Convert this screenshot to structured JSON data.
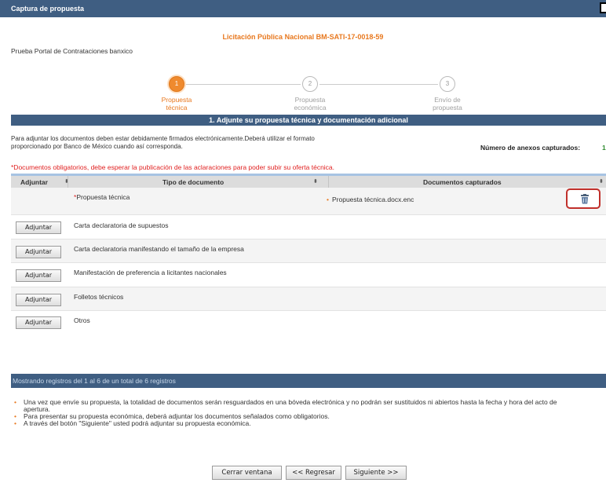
{
  "window": {
    "title": "Captura de propuesta"
  },
  "header": {
    "licitacion": "Licitación Pública Nacional BM-SATI-17-0018-59",
    "proceso": "Prueba Portal de Contrataciones banxico"
  },
  "steps": [
    {
      "number": "1",
      "line1": "Propuesta",
      "line2": "técnica",
      "state": "active"
    },
    {
      "number": "2",
      "line1": "Propuesta",
      "line2": "económica",
      "state": "pending"
    },
    {
      "number": "3",
      "line1": "Envío de",
      "line2": "propuesta",
      "state": "pending"
    }
  ],
  "section": {
    "title": "1. Adjunte su propuesta técnica y documentación adicional"
  },
  "instructions": {
    "line1": "Para adjuntar los documentos deben estar debidamente firmados electrónicamente.Deberá utilizar el formato",
    "line2": "proporcionado por Banco de México cuando así corresponda."
  },
  "anexos": {
    "label": "Número de anexos capturados:",
    "value": "1"
  },
  "warning": "*Documentos obligatorios, debe esperar la publicación de las aclaraciones para poder subir su oferta técnica.",
  "grid": {
    "headers": {
      "adjuntar": "Adjuntar",
      "tipo": "Tipo de documento",
      "capturados": "Documentos capturados"
    },
    "rows": [
      {
        "required_mark": "*",
        "tipo": "Propuesta técnica",
        "captured": "Propuesta técnica.docx.enc",
        "button": ""
      },
      {
        "required_mark": "",
        "tipo": "Carta declaratoria de supuestos",
        "captured": "",
        "button": "Adjuntar"
      },
      {
        "required_mark": "",
        "tipo": "Carta declaratoria manifestando el tamaño de la empresa",
        "captured": "",
        "button": "Adjuntar"
      },
      {
        "required_mark": "",
        "tipo": "Manifestación de preferencia a licitantes nacionales",
        "captured": "",
        "button": "Adjuntar"
      },
      {
        "required_mark": "",
        "tipo": "Folletos técnicos",
        "captured": "",
        "button": "Adjuntar"
      },
      {
        "required_mark": "",
        "tipo": "Otros",
        "captured": "",
        "button": "Adjuntar"
      }
    ],
    "footer": "Mostrando registros del 1 al 6 de un total de 6 registros"
  },
  "notes": {
    "note1_a": "Una vez que envíe su propuesta, la totalidad de documentos serán resguardados en una bóveda electrónica y no podrán ser sustituidos ni abiertos hasta la fecha y hora del acto de",
    "note1_b": "apertura.",
    "note2": "Para presentar su propuesta económica, deberá adjuntar los documentos señalados como obligatorios.",
    "note3": "A través del botón \"Siguiente\" usted podrá adjuntar su propuesta económica."
  },
  "actions": {
    "close": "Cerrar ventana",
    "back": "<< Regresar",
    "next": "Siguiente >>"
  },
  "icons": {
    "sort": "sort-icon",
    "delete": "trash-icon"
  },
  "colors": {
    "header": "#3f5e82",
    "accent": "#e8781e",
    "required": "#e02020",
    "highlight_border": "#c0302b",
    "count": "#2e8b2e"
  }
}
